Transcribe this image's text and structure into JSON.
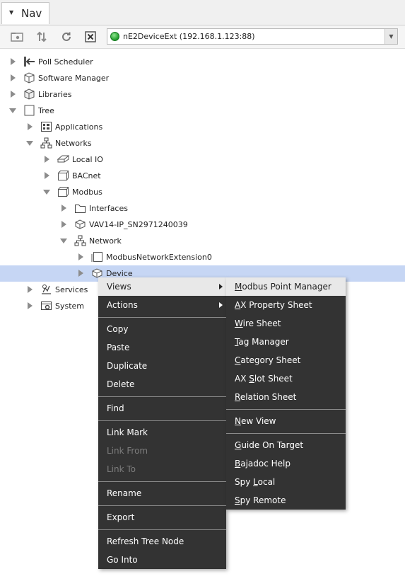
{
  "tab": {
    "title": "Nav"
  },
  "toolbar": {
    "ord_value": "nE2DeviceExt (192.168.1.123:88)",
    "status_color": "#1e9a2a"
  },
  "tree": [
    {
      "label": "Poll Scheduler",
      "state": "closed",
      "icon": "poll-scheduler-icon"
    },
    {
      "label": "Software Manager",
      "state": "closed",
      "icon": "software-manager-icon"
    },
    {
      "label": "Libraries",
      "state": "closed",
      "icon": "libraries-icon"
    },
    {
      "label": "Tree",
      "state": "open",
      "icon": "tree-icon"
    },
    {
      "label": "Applications",
      "state": "closed",
      "icon": "applications-icon"
    },
    {
      "label": "Networks",
      "state": "open",
      "icon": "networks-icon"
    },
    {
      "label": "Local IO",
      "state": "closed",
      "icon": "local-io-icon"
    },
    {
      "label": "BACnet",
      "state": "closed",
      "icon": "bacnet-icon"
    },
    {
      "label": "Modbus",
      "state": "open",
      "icon": "modbus-icon"
    },
    {
      "label": "Interfaces",
      "state": "closed",
      "icon": "folder-icon"
    },
    {
      "label": "VAV14-IP_SN2971240039",
      "state": "closed",
      "icon": "device-icon"
    },
    {
      "label": "Network",
      "state": "open",
      "icon": "network-icon"
    },
    {
      "label": "ModbusNetworkExtension0",
      "state": "closed",
      "icon": "extension-icon"
    },
    {
      "label": "Device",
      "state": "closed",
      "icon": "device-icon",
      "selected": true
    },
    {
      "label": "Services",
      "state": "closed",
      "icon": "services-icon"
    },
    {
      "label": "System",
      "state": "closed",
      "icon": "system-icon"
    }
  ],
  "menu": {
    "views": "Views",
    "actions": "Actions",
    "copy": "Copy",
    "paste": "Paste",
    "duplicate": "Duplicate",
    "delete": "Delete",
    "find": "Find",
    "link_mark": "Link Mark",
    "link_from": "Link From",
    "link_to": "Link To",
    "rename": "Rename",
    "export": "Export",
    "refresh_tree_node": "Refresh Tree Node",
    "go_into": "Go Into"
  },
  "submenu": [
    {
      "mnemonic": "M",
      "rest": "odbus Point Manager"
    },
    {
      "mnemonic": "A",
      "rest": "X Property Sheet"
    },
    {
      "mnemonic": "W",
      "rest": "ire Sheet"
    },
    {
      "mnemonic": "T",
      "rest": "ag Manager"
    },
    {
      "mnemonic": "C",
      "rest": "ategory Sheet"
    },
    {
      "pre": "AX ",
      "mnemonic": "S",
      "rest": "lot Sheet"
    },
    {
      "mnemonic": "R",
      "rest": "elation Sheet"
    },
    {
      "mnemonic": "N",
      "rest": "ew View"
    },
    {
      "mnemonic": "G",
      "rest": "uide On Target"
    },
    {
      "mnemonic": "B",
      "rest": "ajadoc Help"
    },
    {
      "pre": "Spy ",
      "mnemonic": "L",
      "rest": "ocal"
    },
    {
      "mnemonic": "S",
      "rest": "py Remote"
    }
  ]
}
